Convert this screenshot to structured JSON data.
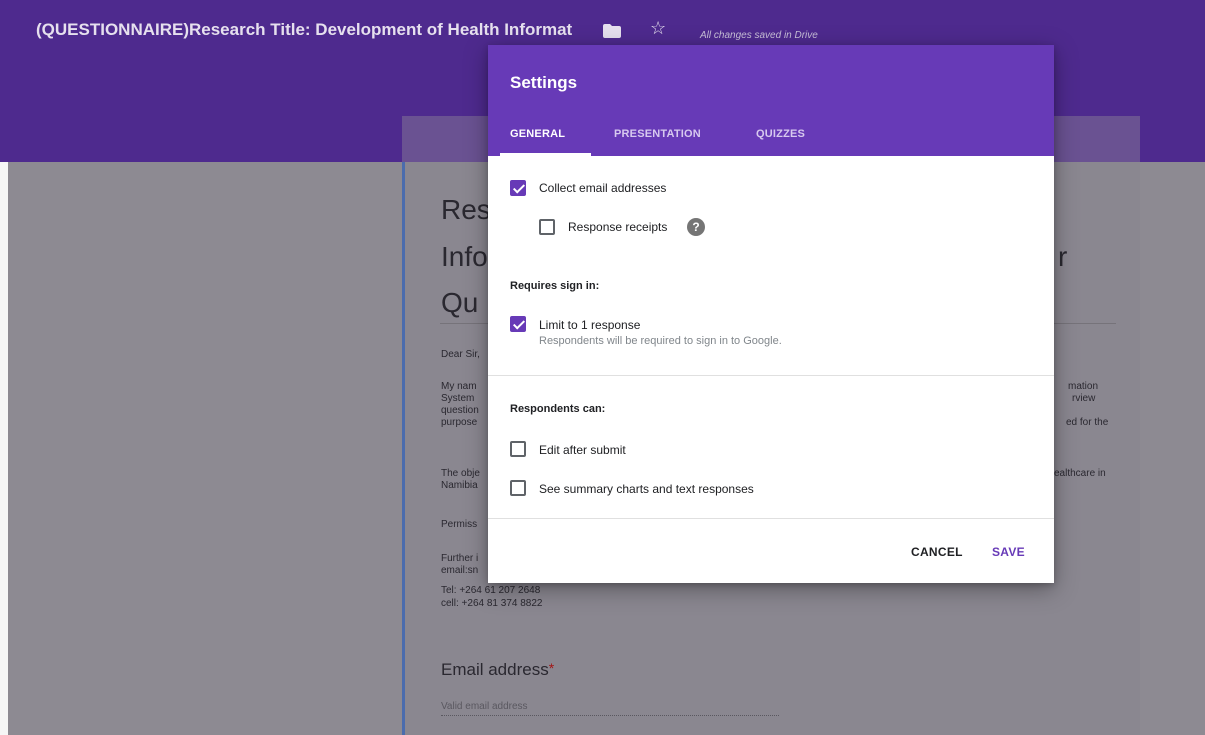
{
  "colors": {
    "header": "#4e2a8e",
    "dialog_accent": "#673ab7",
    "overlay": "#8d8a92"
  },
  "topbar": {
    "doc_title": "(QUESTIONNAIRE)Research Title: Development of Health Informat",
    "folder_icon": "folder-icon",
    "star_icon": "star-icon",
    "save_status": "All changes saved in Drive"
  },
  "form": {
    "title_fragments": [
      "Res",
      "Info",
      "Qu",
      "r"
    ],
    "lines_left": [
      "Dear Sir,",
      "My nam",
      "System",
      "question",
      "purpose",
      "The obje",
      "Namibia",
      "Permiss",
      "Further i",
      "email:sn",
      "Tel:  +264 61 207 2648",
      "cell: +264 81 374 8822"
    ],
    "lines_right": [
      "mation",
      "rview",
      "ed for the",
      "ealthcare in"
    ],
    "email_label": "Email address",
    "email_required": "*",
    "email_placeholder": "Valid email address"
  },
  "dialog": {
    "title": "Settings",
    "tabs": [
      {
        "label": "GENERAL",
        "active": true
      },
      {
        "label": "PRESENTATION",
        "active": false
      },
      {
        "label": "QUIZZES",
        "active": false
      }
    ],
    "general": {
      "collect_email": {
        "label": "Collect email addresses",
        "checked": true
      },
      "response_receipts": {
        "label": "Response receipts",
        "checked": false,
        "help_icon": "help-icon"
      },
      "requires_sign_in_label": "Requires sign in:",
      "limit_one": {
        "label": "Limit to 1 response",
        "sub": "Respondents will be required to sign in to Google.",
        "checked": true
      },
      "respondents_can_label": "Respondents can:",
      "edit_after_submit": {
        "label": "Edit after submit",
        "checked": false
      },
      "see_summary": {
        "label": "See summary charts and text responses",
        "checked": false
      }
    },
    "actions": {
      "cancel": "CANCEL",
      "save": "SAVE"
    }
  }
}
